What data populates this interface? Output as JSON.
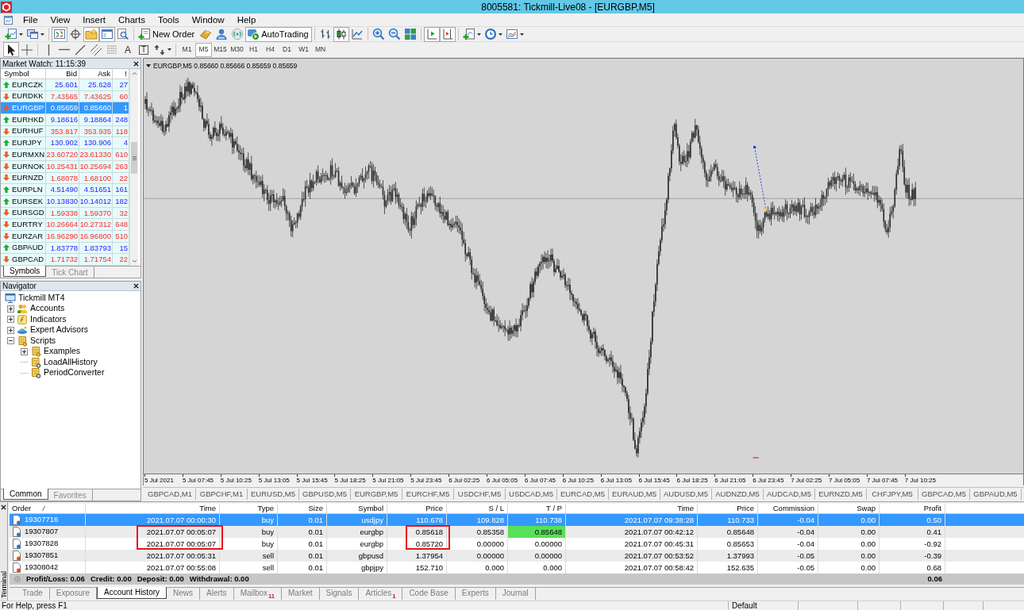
{
  "window": {
    "title": "8005581: Tickmill-Live08 - [EURGBP,M5]"
  },
  "menu": [
    "File",
    "View",
    "Insert",
    "Charts",
    "Tools",
    "Window",
    "Help"
  ],
  "toolbar": [
    {
      "kind": "new-chart",
      "dropdown": true,
      "pressed": false
    },
    {
      "kind": "profiles",
      "dropdown": true,
      "pressed": false
    },
    {
      "kind": "separator"
    },
    {
      "kind": "market-watch",
      "pressed": true
    },
    {
      "kind": "data-window",
      "pressed": false
    },
    {
      "kind": "navigator",
      "pressed": true
    },
    {
      "kind": "terminal",
      "pressed": true
    },
    {
      "kind": "tester",
      "pressed": false
    },
    {
      "kind": "separator"
    },
    {
      "kind": "new-order",
      "label": "New Order",
      "pressed": false
    },
    {
      "kind": "metaeditor",
      "pressed": false
    },
    {
      "kind": "signals",
      "pressed": false
    },
    {
      "kind": "market",
      "pressed": false
    },
    {
      "kind": "autotrading",
      "label": "AutoTrading",
      "pressed": true
    },
    {
      "kind": "separator"
    },
    {
      "kind": "bar-chart",
      "pressed": false
    },
    {
      "kind": "candles",
      "pressed": true
    },
    {
      "kind": "line-chart",
      "pressed": false
    },
    {
      "kind": "separator"
    },
    {
      "kind": "zoom-in",
      "pressed": false
    },
    {
      "kind": "zoom-out",
      "pressed": false
    },
    {
      "kind": "tile",
      "pressed": false
    },
    {
      "kind": "separator"
    },
    {
      "kind": "autoscroll",
      "pressed": true
    },
    {
      "kind": "chart-shift",
      "pressed": true
    },
    {
      "kind": "separator"
    },
    {
      "kind": "indicators",
      "dropdown": true,
      "pressed": false
    },
    {
      "kind": "periods",
      "dropdown": true,
      "pressed": false
    },
    {
      "kind": "templates",
      "dropdown": true,
      "pressed": false
    }
  ],
  "drawing_tools": [
    {
      "kind": "cursor",
      "pressed": true
    },
    {
      "kind": "crosshair",
      "pressed": false
    },
    {
      "kind": "separator"
    },
    {
      "kind": "vline",
      "pressed": false
    },
    {
      "kind": "hline",
      "pressed": false
    },
    {
      "kind": "trendline",
      "pressed": false
    },
    {
      "kind": "channel",
      "pressed": false
    },
    {
      "kind": "fibo",
      "pressed": false
    },
    {
      "kind": "text",
      "label": "A",
      "pressed": false
    },
    {
      "kind": "label",
      "label": "T",
      "pressed": false
    },
    {
      "kind": "arrows",
      "dropdown": true,
      "pressed": false
    },
    {
      "kind": "separator"
    }
  ],
  "timeframes": [
    {
      "label": "M1",
      "selected": false
    },
    {
      "label": "M5",
      "selected": true
    },
    {
      "label": "M15",
      "selected": false
    },
    {
      "label": "M30",
      "selected": false
    },
    {
      "label": "H1",
      "selected": false
    },
    {
      "label": "H4",
      "selected": false
    },
    {
      "label": "D1",
      "selected": false
    },
    {
      "label": "W1",
      "selected": false
    },
    {
      "label": "MN",
      "selected": false
    }
  ],
  "market_watch": {
    "title": "Market Watch: 11:15:39",
    "columns": [
      "Symbol",
      "Bid",
      "Ask",
      "!"
    ],
    "rows": [
      {
        "symbol": "EURCZK",
        "bid": "25.601",
        "ask": "25.628",
        "spread": "27",
        "kind": "up",
        "selected": false
      },
      {
        "symbol": "EURDKK",
        "bid": "7.43565",
        "ask": "7.43625",
        "spread": "60",
        "kind": "down",
        "selected": false
      },
      {
        "symbol": "EURGBP",
        "bid": "0.85659",
        "ask": "0.85660",
        "spread": "1",
        "kind": "down",
        "selected": true
      },
      {
        "symbol": "EURHKD",
        "bid": "9.18616",
        "ask": "9.18864",
        "spread": "248",
        "kind": "up",
        "selected": false
      },
      {
        "symbol": "EURHUF",
        "bid": "353.817",
        "ask": "353.935",
        "spread": "118",
        "kind": "down",
        "selected": false
      },
      {
        "symbol": "EURJPY",
        "bid": "130.902",
        "ask": "130.906",
        "spread": "4",
        "kind": "up",
        "selected": false
      },
      {
        "symbol": "EURMXN",
        "bid": "23.60720",
        "ask": "23.61330",
        "spread": "610",
        "kind": "down",
        "selected": false
      },
      {
        "symbol": "EURNOK",
        "bid": "10.25431",
        "ask": "10.25694",
        "spread": "263",
        "kind": "down",
        "selected": false
      },
      {
        "symbol": "EURNZD",
        "bid": "1.68078",
        "ask": "1.68100",
        "spread": "22",
        "kind": "down",
        "selected": false
      },
      {
        "symbol": "EURPLN",
        "bid": "4.51490",
        "ask": "4.51651",
        "spread": "161",
        "kind": "up",
        "selected": false
      },
      {
        "symbol": "EURSEK",
        "bid": "10.13830",
        "ask": "10.14012",
        "spread": "182",
        "kind": "up",
        "selected": false
      },
      {
        "symbol": "EURSGD",
        "bid": "1.59338",
        "ask": "1.59370",
        "spread": "32",
        "kind": "down",
        "selected": false
      },
      {
        "symbol": "EURTRY",
        "bid": "10.26664",
        "ask": "10.27312",
        "spread": "648",
        "kind": "down",
        "selected": false
      },
      {
        "symbol": "EURZAR",
        "bid": "16.96290",
        "ask": "16.96800",
        "spread": "510",
        "kind": "down",
        "selected": false
      },
      {
        "symbol": "GBPAUD",
        "bid": "1.83778",
        "ask": "1.83793",
        "spread": "15",
        "kind": "up",
        "selected": false
      },
      {
        "symbol": "GBPCAD",
        "bid": "1.71732",
        "ask": "1.71754",
        "spread": "22",
        "kind": "down",
        "selected": false
      }
    ],
    "tabs": [
      {
        "label": "Symbols",
        "selected": true
      },
      {
        "label": "Tick Chart",
        "selected": false
      }
    ]
  },
  "navigator": {
    "title": "Navigator",
    "tree": [
      {
        "label": "Tickmill MT4",
        "kind": "terminal",
        "children": [
          {
            "label": "Accounts",
            "kind": "accounts",
            "expanded": false
          },
          {
            "label": "Indicators",
            "kind": "indicators",
            "expanded": false
          },
          {
            "label": "Expert Advisors",
            "kind": "experts",
            "expanded": false
          },
          {
            "label": "Scripts",
            "kind": "scripts",
            "expanded": true,
            "children": [
              {
                "label": "Examples",
                "kind": "scripts",
                "expanded": false
              },
              {
                "label": "LoadAllHistory",
                "kind": "script"
              },
              {
                "label": "PeriodConverter",
                "kind": "script"
              }
            ]
          }
        ]
      }
    ],
    "tabs": [
      {
        "label": "Common",
        "selected": true
      },
      {
        "label": "Favorites",
        "selected": false
      }
    ]
  },
  "chart": {
    "header": "EURGBP,M5 0.85660 0.85666 0.85659 0.85659",
    "time_labels": [
      "5 Jul 2021",
      "5 Jul 07:45",
      "5 Jul 10:25",
      "5 Jul 13:05",
      "5 Jul 15:45",
      "5 Jul 18:25",
      "5 Jul 21:05",
      "5 Jul 23:45",
      "6 Jul 02:25",
      "6 Jul 05:05",
      "6 Jul 07:45",
      "6 Jul 10:25",
      "6 Jul 13:05",
      "6 Jul 15:45",
      "6 Jul 18:25",
      "6 Jul 21:05",
      "6 Jul 23:45",
      "7 Jul 02:25",
      "7 Jul 05:05",
      "7 Jul 07:45",
      "7 Jul 10:25"
    ],
    "tabs": [
      "GBPCAD,M1",
      "GBPCHF,M1",
      "EURUSD,M5",
      "GBPUSD,M5",
      "EURGBP,M5",
      "EURCHF,M5",
      "USDCHF,M5",
      "USDCAD,M5",
      "EURCAD,M5",
      "EURAUD,M5",
      "AUDUSD,M5",
      "AUDNZD,M5",
      "AUDCAD,M5",
      "EURNZD,M5",
      "CHFJPY,M5",
      "GBPCAD,M5",
      "GBPAUD,M5"
    ]
  },
  "terminal": {
    "title": "Terminal",
    "columns": [
      {
        "label": "Order",
        "sorted": true,
        "framed": false
      },
      {
        "label": "Time",
        "sorted": false,
        "framed": true
      },
      {
        "label": "Type",
        "sorted": false,
        "framed": false
      },
      {
        "label": "Size",
        "sorted": false,
        "framed": false
      },
      {
        "label": "Symbol",
        "sorted": false,
        "framed": false
      },
      {
        "label": "Price",
        "sorted": false,
        "framed": true
      },
      {
        "label": "S / L",
        "sorted": false,
        "framed": false
      },
      {
        "label": "T / P",
        "sorted": false,
        "framed": false
      },
      {
        "label": "Time",
        "sorted": false,
        "framed": false
      },
      {
        "label": "Price",
        "sorted": false,
        "framed": false
      },
      {
        "label": "Commission",
        "sorted": false,
        "framed": false
      },
      {
        "label": "Swap",
        "sorted": false,
        "framed": false
      },
      {
        "label": "Profit",
        "sorted": false,
        "framed": false
      }
    ],
    "rows": [
      {
        "kind": "buy",
        "selected": true,
        "framed": false,
        "tp_hit": false,
        "cells": [
          "19307716",
          "2021.07.07 00:00:30",
          "buy",
          "0.01",
          "usdjpy",
          "110.678",
          "109.828",
          "110.738",
          "2021.07.07 09:38:28",
          "110.733",
          "-0.04",
          "0.00",
          "0.50"
        ]
      },
      {
        "kind": "buy",
        "selected": false,
        "framed": true,
        "tp_hit": true,
        "cells": [
          "19307807",
          "2021.07.07 00:05:07",
          "buy",
          "0.01",
          "eurgbp",
          "0.85618",
          "0.85358",
          "0.85648",
          "2021.07.07 00:42:12",
          "0.85648",
          "-0.04",
          "0.00",
          "0.41"
        ]
      },
      {
        "kind": "buy",
        "selected": false,
        "framed": true,
        "tp_hit": false,
        "cells": [
          "19307828",
          "2021.07.07 00:05:07",
          "buy",
          "0.01",
          "eurgbp",
          "0.85720",
          "0.00000",
          "0.00000",
          "2021.07.07 00:45:31",
          "0.85653",
          "-0.04",
          "0.00",
          "-0.92"
        ]
      },
      {
        "kind": "sell",
        "selected": false,
        "framed": false,
        "tp_hit": false,
        "cells": [
          "19307851",
          "2021.07.07 00:05:31",
          "sell",
          "0.01",
          "gbpusd",
          "1.37954",
          "0.00000",
          "0.00000",
          "2021.07.07 00:53:52",
          "1.37993",
          "-0.05",
          "0.00",
          "-0.39"
        ]
      },
      {
        "kind": "sell",
        "selected": false,
        "framed": false,
        "tp_hit": false,
        "cells": [
          "19308042",
          "2021.07.07 00:55:08",
          "sell",
          "0.01",
          "gbpjpy",
          "152.710",
          "0.000",
          "0.000",
          "2021.07.07 00:58:42",
          "152.635",
          "-0.05",
          "0.00",
          "0.68"
        ]
      }
    ],
    "summary": [
      "Profit/Loss: 0.06",
      "Credit: 0.00",
      "Deposit: 0.00",
      "Withdrawal: 0.00"
    ],
    "total": "0.06",
    "tabs": [
      {
        "label": "Trade",
        "selected": false
      },
      {
        "label": "Exposure",
        "selected": false
      },
      {
        "label": "Account History",
        "selected": true
      },
      {
        "label": "News",
        "selected": false
      },
      {
        "label": "Alerts",
        "selected": false
      },
      {
        "label": "Mailbox",
        "selected": false,
        "badge": "11"
      },
      {
        "label": "Market",
        "selected": false
      },
      {
        "label": "Signals",
        "selected": false
      },
      {
        "label": "Articles",
        "selected": false,
        "badge": "1"
      },
      {
        "label": "Code Base",
        "selected": false
      },
      {
        "label": "Experts",
        "selected": false
      },
      {
        "label": "Journal",
        "selected": false
      }
    ]
  },
  "status_bar": {
    "help": "For Help, press F1",
    "profile": "Default"
  }
}
